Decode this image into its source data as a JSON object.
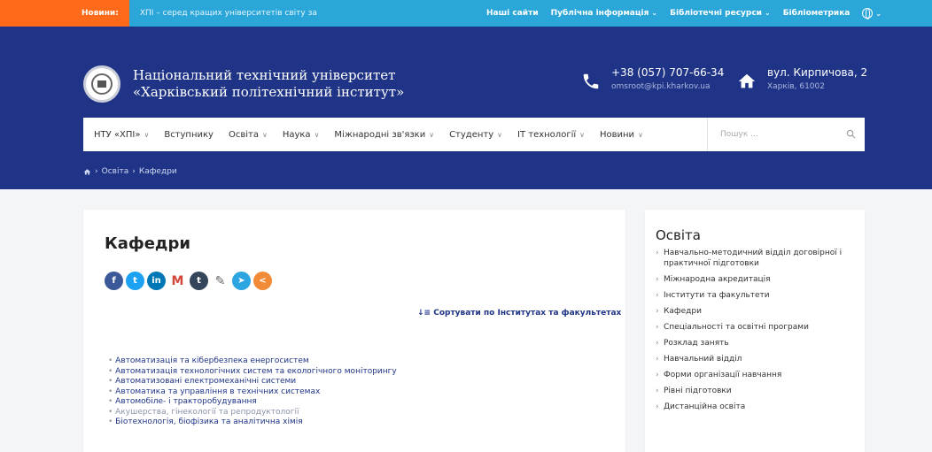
{
  "topbar": {
    "news_label": "Новини:",
    "ticker_text": "ХПІ – серед кращих університетів світу за",
    "links": [
      {
        "label": "Наші сайти",
        "has_dropdown": false
      },
      {
        "label": "Публічна інформація",
        "has_dropdown": true
      },
      {
        "label": "Бібліотечні ресурси",
        "has_dropdown": true
      },
      {
        "label": "Бібліометрика",
        "has_dropdown": false
      }
    ],
    "colors": {
      "bar": "#2aa6d9",
      "news_tag": "#ff6a1a"
    }
  },
  "header": {
    "name_line1": "Національний технічний університет",
    "name_line2": "«Харківський політехнічний інститут»",
    "phone": "+38 (057) 707-66-34",
    "email": "omsroot@kpi.kharkov.ua",
    "address": "вул. Кирпичова, 2",
    "city": "Харків, 61002",
    "bg_color": "#1f3487"
  },
  "nav": {
    "items": [
      {
        "label": "НТУ «ХПІ»",
        "has_dropdown": true
      },
      {
        "label": "Вступнику",
        "has_dropdown": false
      },
      {
        "label": "Освіта",
        "has_dropdown": true
      },
      {
        "label": "Наука",
        "has_dropdown": true
      },
      {
        "label": "Міжнародні зв'язки",
        "has_dropdown": true
      },
      {
        "label": "Студенту",
        "has_dropdown": true
      },
      {
        "label": "ІТ технології",
        "has_dropdown": true
      },
      {
        "label": "Новини",
        "has_dropdown": true
      }
    ],
    "search_placeholder": "Пошук ..."
  },
  "breadcrumb": {
    "home_icon": "home-icon",
    "items": [
      "Освіта",
      "Кафедри"
    ],
    "separator": "›"
  },
  "main": {
    "title": "Кафедри",
    "share_icons": [
      {
        "name": "facebook-icon",
        "glyph": "f",
        "color": "#3b5998"
      },
      {
        "name": "twitter-icon",
        "glyph": "t",
        "color": "#1da1f2"
      },
      {
        "name": "linkedin-icon",
        "glyph": "in",
        "color": "#0077b5"
      },
      {
        "name": "gmail-icon",
        "glyph": "M",
        "color": "#ffffff"
      },
      {
        "name": "tumblr-icon",
        "glyph": "t",
        "color": "#35465c"
      },
      {
        "name": "edit-icon",
        "glyph": "✎",
        "color": "#ffffff"
      },
      {
        "name": "telegram-icon",
        "glyph": "➤",
        "color": "#2ca5e0"
      },
      {
        "name": "share-icon",
        "glyph": "<",
        "color": "#f28b38"
      }
    ],
    "sort_link": "Сортувати по Інститутах та факультетах",
    "departments": [
      {
        "label": "Автоматизація та кібербезпека енергосистем",
        "muted": false
      },
      {
        "label": "Автоматизація технологічних систем та екологічного моніторингу",
        "muted": false
      },
      {
        "label": "Автоматизовані електромеханічні системи",
        "muted": false
      },
      {
        "label": "Автоматика та управління в технічних системах",
        "muted": false
      },
      {
        "label": "Автомобіле- і тракторобудування",
        "muted": false
      },
      {
        "label": "Акушерства, гінекології та репродуктології",
        "muted": true
      },
      {
        "label": "Біотехнологія, біофізика та аналітична хімія",
        "muted": false
      }
    ]
  },
  "sidebar": {
    "title": "Освіта",
    "items": [
      "Навчально-методичний відділ договірної і практичної підготовки",
      "Міжнародна акредитація",
      "Інститути та факультети",
      "Кафедри",
      "Спеціальності та освітні програми",
      "Розклад занять",
      "Навчальний відділ",
      "Форми організації навчання",
      "Рівні підготовки",
      "Дистанційна освіта"
    ]
  }
}
